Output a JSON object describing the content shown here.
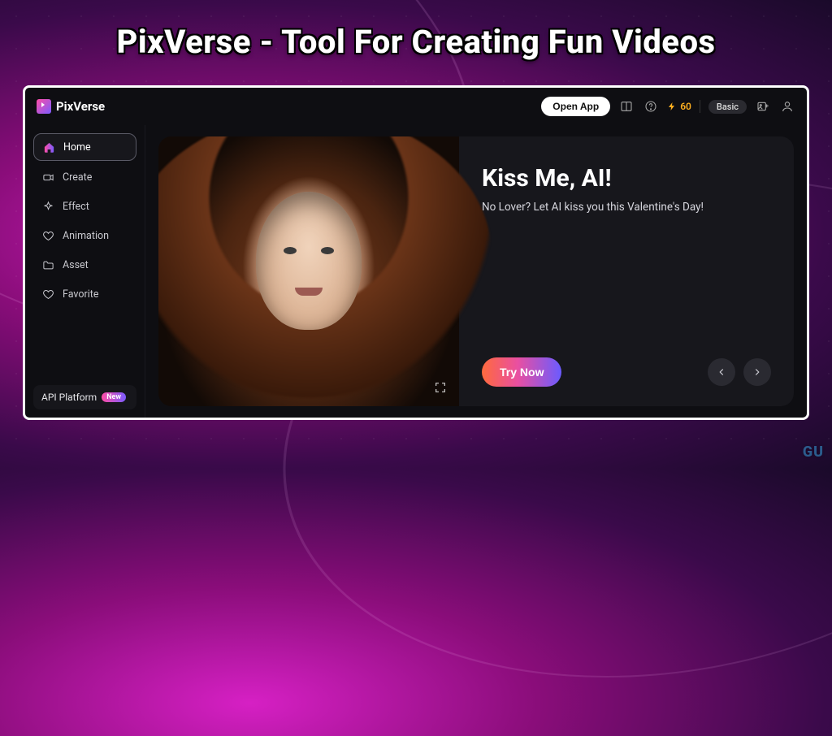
{
  "banner": {
    "title": "PixVerse - Tool For Creating Fun Videos"
  },
  "brand": {
    "name": "PixVerse"
  },
  "topbar": {
    "open_app": "Open App",
    "credits": "60",
    "plan": "Basic"
  },
  "sidebar": {
    "items": [
      {
        "label": "Home",
        "icon": "home-icon",
        "active": true
      },
      {
        "label": "Create",
        "icon": "camera-icon",
        "active": false
      },
      {
        "label": "Effect",
        "icon": "sparkle-icon",
        "active": false
      },
      {
        "label": "Animation",
        "icon": "heart-icon",
        "active": false
      },
      {
        "label": "Asset",
        "icon": "folder-icon",
        "active": false
      },
      {
        "label": "Favorite",
        "icon": "heart-outline-icon",
        "active": false
      }
    ],
    "api_label": "API Platform",
    "api_badge": "New"
  },
  "hero": {
    "title": "Kiss Me, AI!",
    "subtitle": "No Lover? Let AI kiss you this Valentine's Day!",
    "cta": "Try Now"
  },
  "watermark": "GU"
}
